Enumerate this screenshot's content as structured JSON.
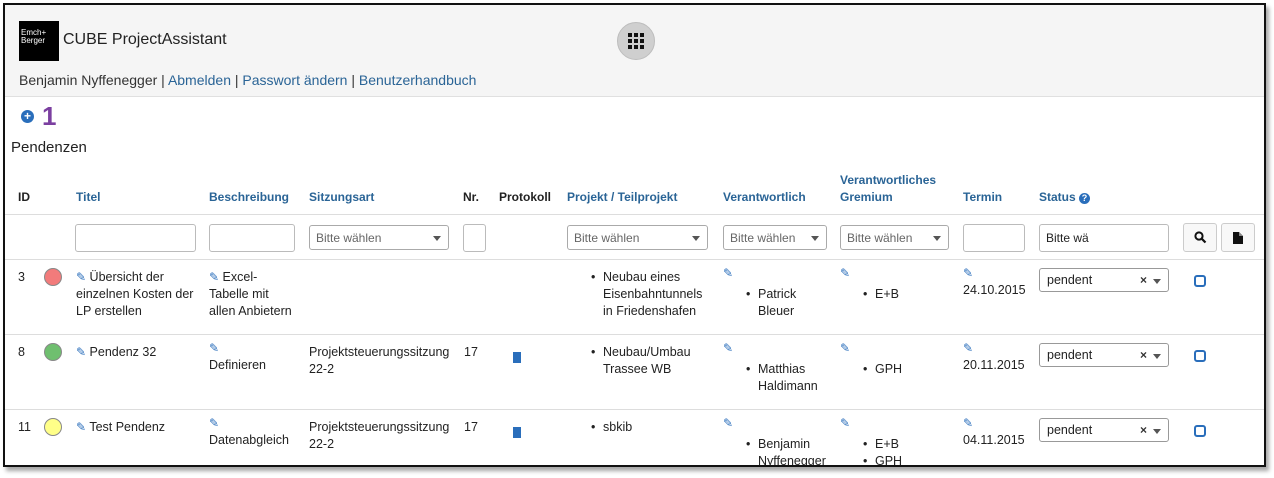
{
  "header": {
    "logo_text": "Emch+ Berger",
    "app_title": "CUBE ProjectAssistant",
    "user_name": "Benjamin Nyffenegger",
    "links": [
      "Abmelden",
      "Passwort ändern",
      "Benutzerhandbuch"
    ],
    "separator": "|"
  },
  "icons": {
    "apps": "grid-icon",
    "add": "plus-circle-icon",
    "edit": "pencil-icon",
    "protocol": "document-icon",
    "search": "search-icon",
    "export": "file-icon",
    "row_edit": "edit-square-icon",
    "help": "question-circle-icon"
  },
  "count": "1",
  "section_title": "Pendenzen",
  "columns": {
    "id": "ID",
    "titel": "Titel",
    "beschreibung": "Beschreibung",
    "sitzungsart": "Sitzungsart",
    "nr": "Nr.",
    "protokoll": "Protokoll",
    "projekt": "Projekt / Teilprojekt",
    "verantwortlich": "Verantwortlich",
    "gremium_line1": "Verantwortliches",
    "gremium_line2": "Gremium",
    "termin": "Termin",
    "status": "Status"
  },
  "filters": {
    "sitzungsart": "Bitte wählen",
    "projekt": "Bitte wählen",
    "verantwortlich": "Bitte wählen",
    "gremium": "Bitte wählen",
    "status": "Bitte wä"
  },
  "colors": {
    "link": "#2a6496",
    "accent": "#2a6ebb",
    "count": "#7b3fa0",
    "traffic_red": "#f27b7b",
    "traffic_green": "#6fbf6f",
    "traffic_yellow": "#ffff88"
  },
  "rows": [
    {
      "id": "3",
      "traffic": "red",
      "titel": [
        "Übersicht der",
        "einzelnen Kosten der",
        "LP erstellen"
      ],
      "beschreibung": [
        "Excel-",
        "Tabelle mit",
        "allen Anbietern"
      ],
      "sitzungsart": [
        "",
        ""
      ],
      "nr": "",
      "protokoll": false,
      "projekt": [
        "Neubau eines",
        "Eisenbahntunnels",
        "in Friedenshafen"
      ],
      "verantwortlich": [
        "Patrick",
        "Bleuer"
      ],
      "gremium": [
        "E+B"
      ],
      "termin": "24.10.2015",
      "status": "pendent"
    },
    {
      "id": "8",
      "traffic": "green",
      "titel": [
        "Pendenz 32",
        "",
        ""
      ],
      "beschreibung": [
        "Definieren",
        "",
        ""
      ],
      "sitzungsart": [
        "Projektsteuerungssitzung",
        "22-2"
      ],
      "nr": "17",
      "protokoll": true,
      "projekt": [
        "Neubau/Umbau",
        "Trassee WB",
        ""
      ],
      "verantwortlich": [
        "Matthias",
        "Haldimann"
      ],
      "gremium": [
        "GPH"
      ],
      "termin": "20.11.2015",
      "status": "pendent"
    },
    {
      "id": "11",
      "traffic": "yellow",
      "titel": [
        "Test Pendenz",
        "",
        ""
      ],
      "beschreibung": [
        "Datenabgleich",
        "",
        ""
      ],
      "sitzungsart": [
        "Projektsteuerungssitzung",
        "22-2"
      ],
      "nr": "17",
      "protokoll": true,
      "projekt": [
        "sbkib",
        "",
        ""
      ],
      "verantwortlich": [
        "Benjamin",
        "Nyffenegger"
      ],
      "gremium": [
        "E+B",
        "GPH"
      ],
      "termin": "04.11.2015",
      "status": "pendent"
    }
  ]
}
